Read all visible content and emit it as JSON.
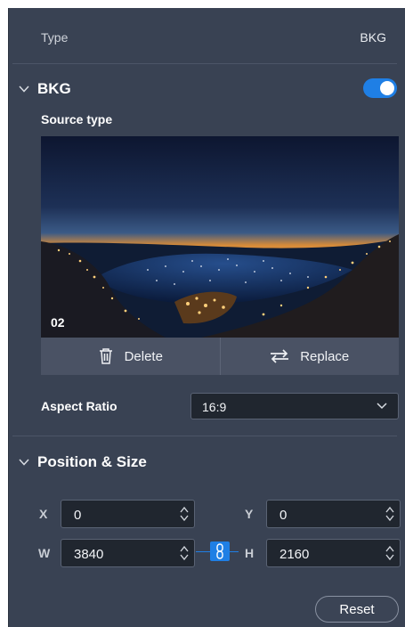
{
  "type_row": {
    "label": "Type",
    "value": "BKG"
  },
  "bkg_section": {
    "title": "BKG",
    "enabled": true,
    "source_type_label": "Source type",
    "preview_index": "02",
    "delete_label": "Delete",
    "replace_label": "Replace"
  },
  "aspect_ratio": {
    "label": "Aspect Ratio",
    "value": "16:9"
  },
  "position_section": {
    "title": "Position & Size",
    "x_label": "X",
    "x_value": "0",
    "y_label": "Y",
    "y_value": "0",
    "w_label": "W",
    "w_value": "3840",
    "h_label": "H",
    "h_value": "2160",
    "reset_label": "Reset"
  },
  "colors": {
    "accent": "#1f7fe5",
    "panel": "#394253",
    "input": "#20262f"
  },
  "icons": [
    "chevron-down-icon",
    "toggle-switch",
    "trash-icon",
    "swap-arrows-icon",
    "spinner-arrows-icon",
    "link-icon"
  ]
}
